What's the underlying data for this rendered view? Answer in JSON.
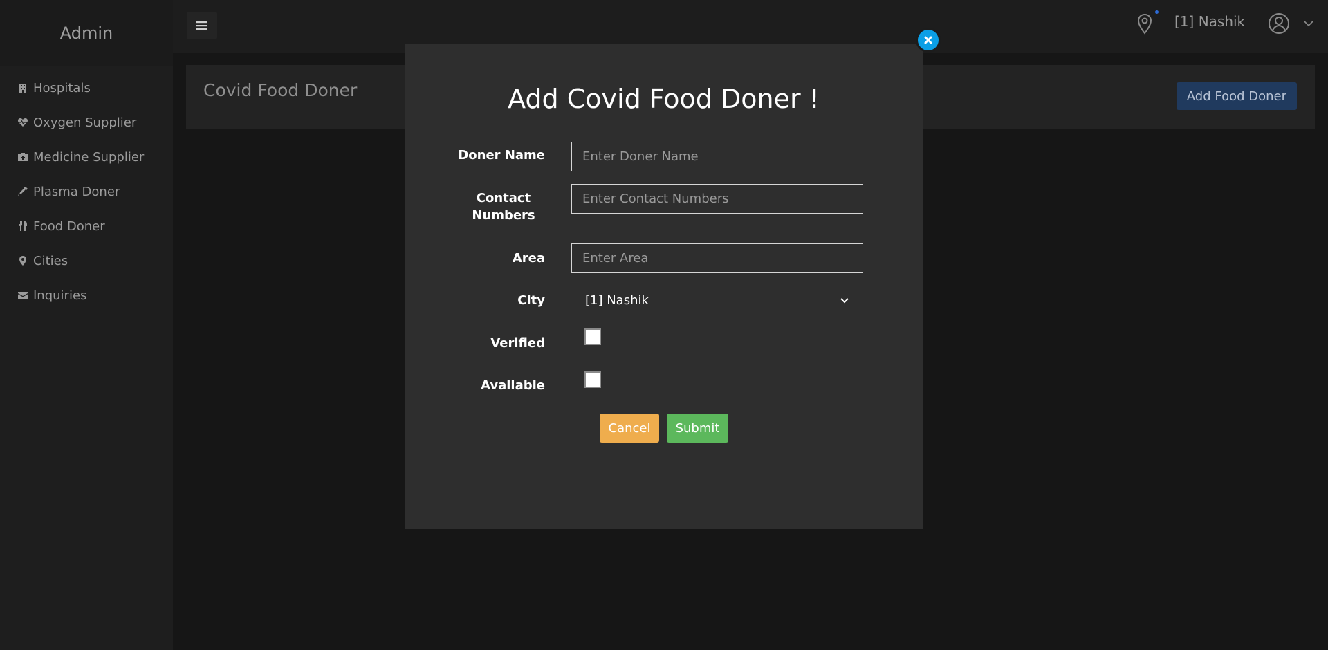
{
  "sidebar": {
    "brand": "Admin",
    "items": [
      {
        "label": "Hospitals",
        "icon": "hospital-icon"
      },
      {
        "label": "Oxygen Supplier",
        "icon": "heartbeat-icon"
      },
      {
        "label": "Medicine Supplier",
        "icon": "medkit-icon"
      },
      {
        "label": "Plasma Doner",
        "icon": "eyedropper-icon"
      },
      {
        "label": "Food Doner",
        "icon": "cutlery-icon"
      },
      {
        "label": "Cities",
        "icon": "map-marker-icon"
      },
      {
        "label": "Inquiries",
        "icon": "envelope-icon"
      }
    ]
  },
  "topbar": {
    "city": "[1] Nashik"
  },
  "content": {
    "title": "Covid Food Doner",
    "add_button": "Add Food Doner"
  },
  "modal": {
    "title": "Add Covid Food Doner !",
    "fields": {
      "name_label": "Doner Name",
      "name_placeholder": "Enter Doner Name",
      "contact_label": "Contact Numbers",
      "contact_placeholder": "Enter Contact Numbers",
      "area_label": "Area",
      "area_placeholder": "Enter Area",
      "city_label": "City",
      "city_value": "[1] Nashik",
      "verified_label": "Verified",
      "available_label": "Available"
    },
    "cancel_label": "Cancel",
    "submit_label": "Submit"
  },
  "colors": {
    "background": "#161616",
    "sidebar": "#1e1e1e",
    "modal": "#2e2e2e",
    "close": "#0b9fe6",
    "cancel": "#efad4d",
    "submit": "#5cb85c",
    "primary_button": "#203a5e"
  }
}
